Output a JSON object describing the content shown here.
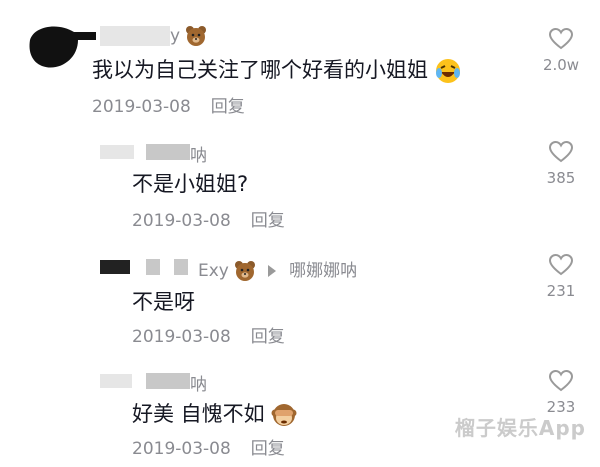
{
  "comments": [
    {
      "name_visible": "y",
      "text": "我以为自己关注了哪个好看的小姐姐",
      "date": "2019-03-08",
      "reply_label": "回复",
      "likes": "2.0w"
    },
    {
      "name_visible": "呐",
      "text": "不是小姐姐?",
      "date": "2019-03-08",
      "reply_label": "回复",
      "likes": "385"
    },
    {
      "name_visible": "Exy",
      "reply_to": "哪娜娜呐",
      "text": "不是呀",
      "date": "2019-03-08",
      "reply_label": "回复",
      "likes": "231"
    },
    {
      "name_visible": "呐",
      "text": "好美 自愧不如",
      "date": "2019-03-08",
      "reply_label": "回复",
      "likes": "233"
    }
  ],
  "watermark": "榴子娱乐App",
  "icons": {
    "like": "heart-outline-icon",
    "bear": "bear-emoji-icon",
    "crying": "crying-laughing-emoji-icon",
    "see_no_evil": "see-no-evil-monkey-emoji-icon",
    "reply_arrow": "play-arrow-icon"
  }
}
